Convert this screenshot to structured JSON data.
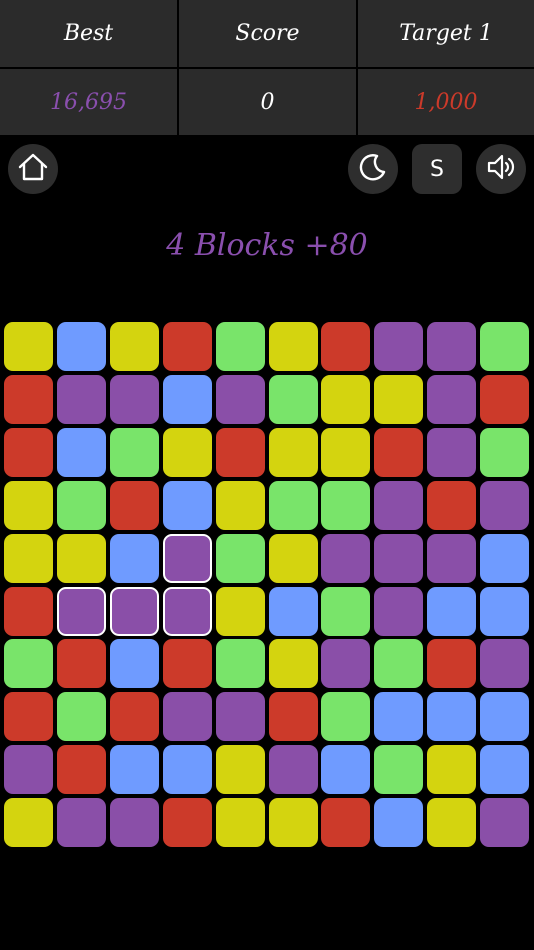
{
  "header": {
    "best_label": "Best",
    "score_label": "Score",
    "target_label": "Target 1",
    "best_value": "16,695",
    "score_value": "0",
    "target_value": "1,000"
  },
  "colors": {
    "best_value": "#8a4fae",
    "score_value": "#ffffff",
    "target_value": "#cc3a2a",
    "message": "#8a4fae",
    "Y": "#d4d40f",
    "B": "#6f9bff",
    "R": "#cc3a2a",
    "G": "#79e46a",
    "P": "#8a4fa8"
  },
  "toolbar": {
    "home_icon": "home-icon",
    "night_icon": "moon-icon",
    "s_label": "S",
    "sound_icon": "speaker-icon"
  },
  "message": "4 Blocks +80",
  "board": {
    "rows": [
      [
        "Y",
        "B",
        "Y",
        "R",
        "G",
        "Y",
        "R",
        "P",
        "P",
        "G"
      ],
      [
        "R",
        "P",
        "P",
        "B",
        "P",
        "G",
        "Y",
        "Y",
        "P",
        "R"
      ],
      [
        "R",
        "B",
        "G",
        "Y",
        "R",
        "Y",
        "Y",
        "R",
        "P",
        "G"
      ],
      [
        "Y",
        "G",
        "R",
        "B",
        "Y",
        "G",
        "G",
        "P",
        "R",
        "P"
      ],
      [
        "Y",
        "Y",
        "B",
        "P",
        "G",
        "Y",
        "P",
        "P",
        "P",
        "B"
      ],
      [
        "R",
        "P",
        "P",
        "P",
        "Y",
        "B",
        "G",
        "P",
        "B",
        "B"
      ],
      [
        "G",
        "R",
        "B",
        "R",
        "G",
        "Y",
        "P",
        "G",
        "R",
        "P"
      ],
      [
        "R",
        "G",
        "R",
        "P",
        "P",
        "R",
        "G",
        "B",
        "B",
        "B"
      ],
      [
        "P",
        "R",
        "B",
        "B",
        "Y",
        "P",
        "B",
        "G",
        "Y",
        "B"
      ],
      [
        "Y",
        "P",
        "P",
        "R",
        "Y",
        "Y",
        "R",
        "B",
        "Y",
        "P"
      ]
    ],
    "selected": [
      [
        4,
        3
      ],
      [
        5,
        1
      ],
      [
        5,
        2
      ],
      [
        5,
        3
      ]
    ]
  }
}
